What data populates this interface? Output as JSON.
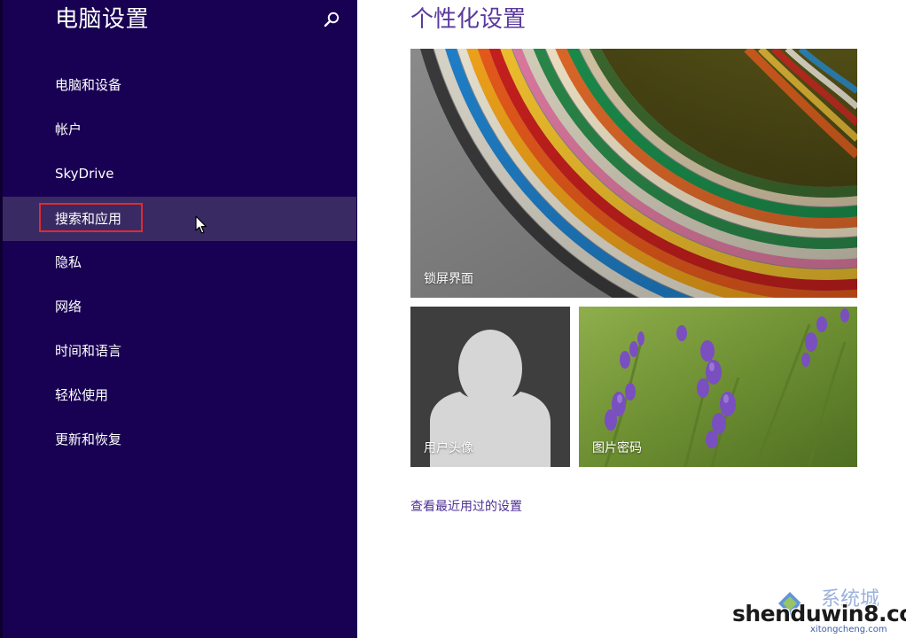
{
  "sidebar": {
    "title": "电脑设置",
    "search_icon": "search-icon",
    "items": [
      {
        "label": "电脑和设备"
      },
      {
        "label": "帐户"
      },
      {
        "label": "SkyDrive"
      },
      {
        "label": "搜索和应用",
        "selected": true,
        "highlighted": true
      },
      {
        "label": "隐私"
      },
      {
        "label": "网络"
      },
      {
        "label": "时间和语言"
      },
      {
        "label": "轻松使用"
      },
      {
        "label": "更新和恢复"
      }
    ]
  },
  "main": {
    "title": "个性化设置",
    "tiles": [
      {
        "label": "锁屏界面"
      },
      {
        "label": "用户头像"
      },
      {
        "label": "图片密码"
      }
    ],
    "recent_link": "查看最近用过的设置"
  },
  "watermark": {
    "cn_text": "系统城",
    "main_text": "shenduwin8.com",
    "sub_text": "xitongcheng.com"
  },
  "colors": {
    "sidebar_bg": "#180052",
    "sidebar_selected": "#3a2a64",
    "accent_purple": "#5a3a9e",
    "highlight_red": "#e02a30"
  }
}
